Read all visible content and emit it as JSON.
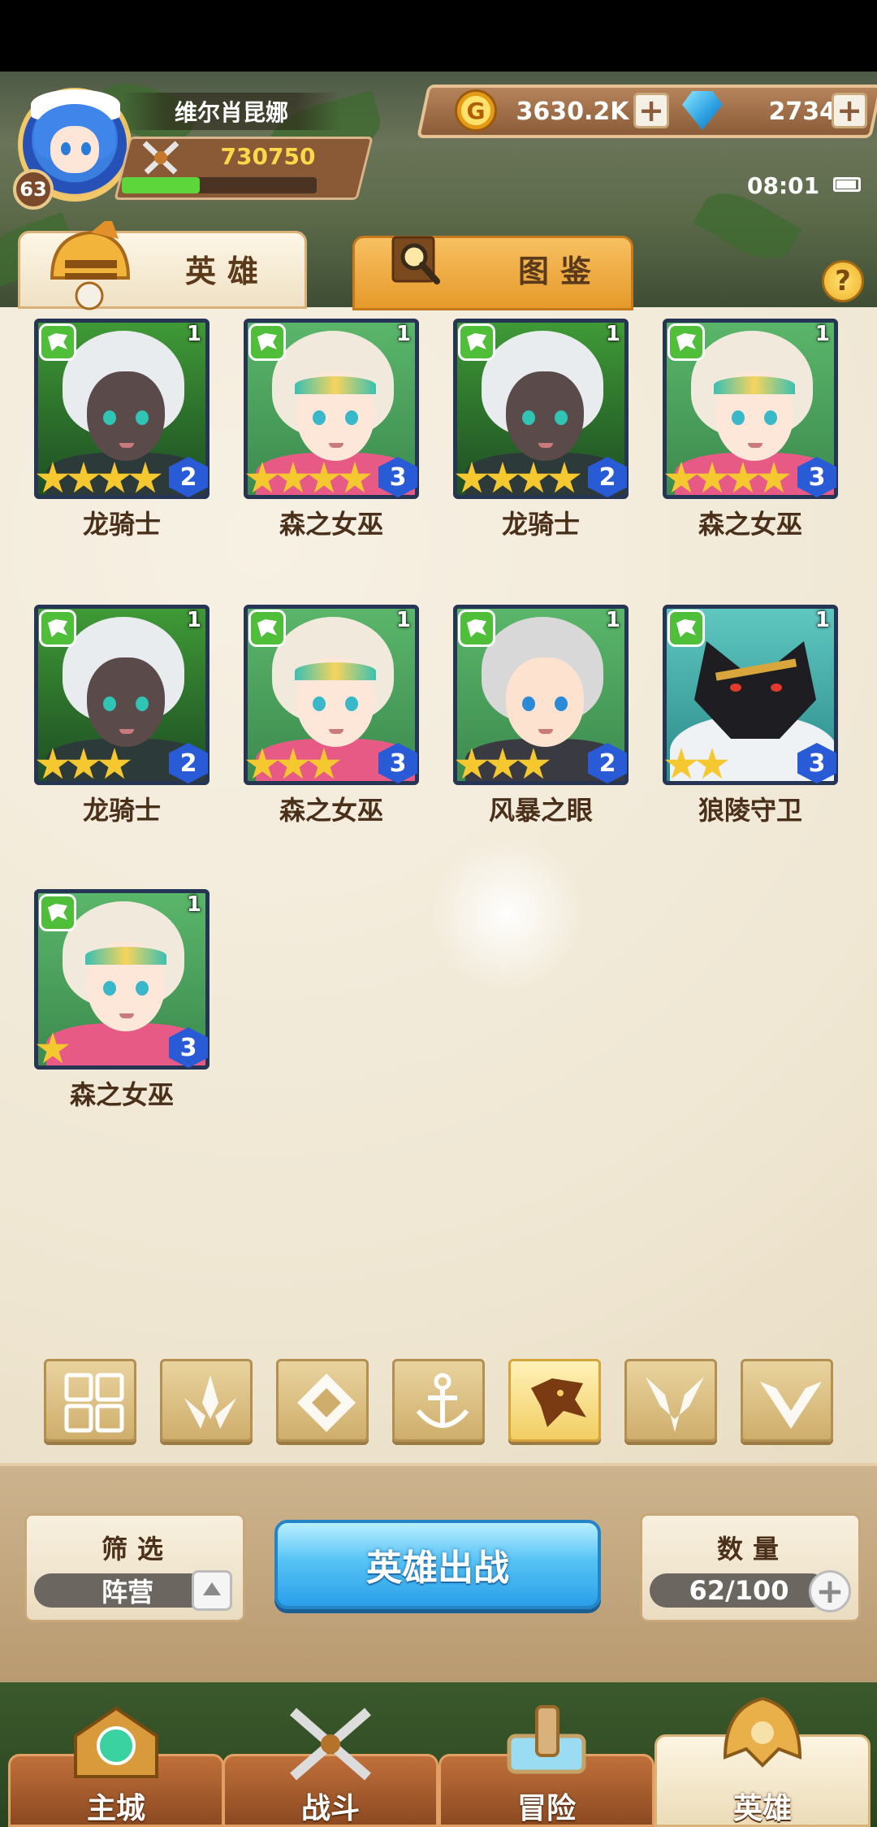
{
  "player": {
    "name": "维尔肖昆娜",
    "level": "63",
    "power": "730750",
    "exp_fraction": 0.4
  },
  "currency": {
    "gold": "3630.2K",
    "gems": "2734",
    "plus": "+"
  },
  "status": {
    "time": "08:01"
  },
  "tabs": {
    "heroes": "英雄",
    "codex": "图鉴",
    "help": "?"
  },
  "heroes": [
    {
      "name": "龙骑士",
      "stars": 4,
      "level": "2",
      "count": "1",
      "look": "dark-elf"
    },
    {
      "name": "森之女巫",
      "stars": 4,
      "level": "3",
      "count": "1",
      "look": "elf-witch"
    },
    {
      "name": "龙骑士",
      "stars": 4,
      "level": "2",
      "count": "1",
      "look": "dark-elf"
    },
    {
      "name": "森之女巫",
      "stars": 4,
      "level": "3",
      "count": "1",
      "look": "elf-witch"
    },
    {
      "name": "龙骑士",
      "stars": 3,
      "level": "2",
      "count": "1",
      "look": "dark-elf"
    },
    {
      "name": "森之女巫",
      "stars": 3,
      "level": "3",
      "count": "1",
      "look": "elf-witch"
    },
    {
      "name": "风暴之眼",
      "stars": 3,
      "level": "2",
      "count": "1",
      "look": "storm-boy"
    },
    {
      "name": "狼陵守卫",
      "stars": 2,
      "level": "3",
      "count": "1",
      "look": "wolf-guard"
    },
    {
      "name": "森之女巫",
      "stars": 1,
      "level": "3",
      "count": "1",
      "look": "elf-witch"
    }
  ],
  "faction_filters": [
    {
      "icon": "grid-icon",
      "active": false
    },
    {
      "icon": "leaf-crest-icon",
      "active": false
    },
    {
      "icon": "diamond-crest-icon",
      "active": false
    },
    {
      "icon": "anchor-icon",
      "active": false
    },
    {
      "icon": "beast-head-icon",
      "active": true
    },
    {
      "icon": "demon-horn-icon",
      "active": false
    },
    {
      "icon": "wing-v-icon",
      "active": false
    }
  ],
  "bottom": {
    "filter_title": "筛选",
    "filter_value": "阵营",
    "deploy_label": "英雄出战",
    "count_title": "数量",
    "count_value": "62/100"
  },
  "nav": [
    {
      "label": "主城",
      "icon": "city-icon",
      "active": false
    },
    {
      "label": "战斗",
      "icon": "crossed-swords-icon",
      "active": false
    },
    {
      "label": "冒险",
      "icon": "map-scroll-icon",
      "active": false
    },
    {
      "label": "英雄",
      "icon": "hero-helmet-icon",
      "active": true
    }
  ],
  "colors": {
    "parchment": "#efe6d2",
    "accent_blue": "#2aa0ea",
    "gold_text": "#ffd84a",
    "exp_green": "#5cd63a"
  }
}
